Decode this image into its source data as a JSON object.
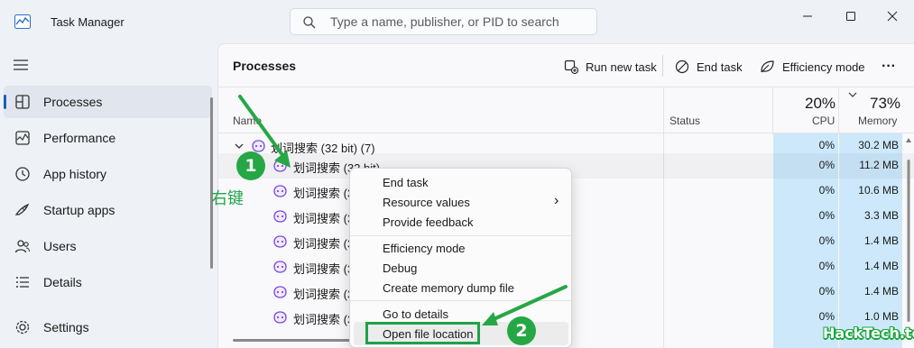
{
  "window": {
    "title": "Task Manager",
    "controls": [
      "minimize",
      "maximize",
      "close"
    ]
  },
  "search": {
    "placeholder": "Type a name, publisher, or PID to search"
  },
  "sidebar": {
    "items": [
      {
        "label": "Processes",
        "icon": "processes-icon",
        "active": true
      },
      {
        "label": "Performance",
        "icon": "performance-icon"
      },
      {
        "label": "App history",
        "icon": "app-history-icon"
      },
      {
        "label": "Startup apps",
        "icon": "startup-apps-icon"
      },
      {
        "label": "Users",
        "icon": "users-icon"
      },
      {
        "label": "Details",
        "icon": "details-icon"
      }
    ],
    "settings_label": "Settings"
  },
  "main": {
    "title": "Processes",
    "toolbar": {
      "run_new_task": "Run new task",
      "end_task": "End task",
      "efficiency_mode": "Efficiency mode",
      "more": "···"
    },
    "columns": {
      "name": "Name",
      "status": "Status",
      "cpu_pct": "20%",
      "cpu": "CPU",
      "mem_pct": "73%",
      "memory": "Memory"
    },
    "rows": [
      {
        "name": "划词搜索 (32 bit) (7)",
        "cpu": "0%",
        "mem": "30.2 MB"
      },
      {
        "name": "划词搜索 (32 bit)",
        "cpu": "0%",
        "mem": "11.2 MB"
      },
      {
        "name": "划词搜索 (3",
        "cpu": "0%",
        "mem": "10.6 MB"
      },
      {
        "name": "划词搜索 (3",
        "cpu": "0%",
        "mem": "3.3 MB"
      },
      {
        "name": "划词搜索 (3",
        "cpu": "0%",
        "mem": "1.4 MB"
      },
      {
        "name": "划词搜索 (3",
        "cpu": "0%",
        "mem": "1.4 MB"
      },
      {
        "name": "划词搜索 (3",
        "cpu": "0%",
        "mem": "1.4 MB"
      },
      {
        "name": "划词搜索 (3",
        "cpu": "0%",
        "mem": "1.0 MB"
      }
    ]
  },
  "context_menu": {
    "items": [
      "End task",
      "Resource values",
      "Provide feedback",
      "Efficiency mode",
      "Debug",
      "Create memory dump file",
      "Go to details",
      "Open file location"
    ],
    "submenu_arrow": "›"
  },
  "annotations": {
    "right_click": "右键",
    "step1": "1",
    "step2": "2",
    "watermark": "HackTech.top",
    "accent_color": "#26a745"
  }
}
